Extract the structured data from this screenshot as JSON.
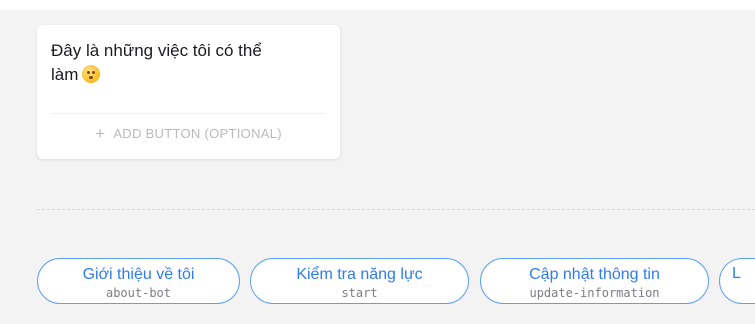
{
  "card": {
    "message_line1": "Đây là những việc tôi có thể",
    "message_line2": "làm",
    "emoji_icon": "kissing-face-emoji",
    "add_button_label": "ADD BUTTON (OPTIONAL)"
  },
  "quick_replies": [
    {
      "label": "Giới thiệu về tôi",
      "id": "about-bot"
    },
    {
      "label": "Kiểm tra năng lực",
      "id": "start"
    },
    {
      "label": "Cập nhật thông tin",
      "id": "update-information"
    },
    {
      "label": "L",
      "id": ""
    }
  ],
  "colors": {
    "accent": "#2f7cf0",
    "chip_border": "#5c9ff5",
    "muted": "#b9b9bf",
    "background": "#f3f3f4"
  }
}
